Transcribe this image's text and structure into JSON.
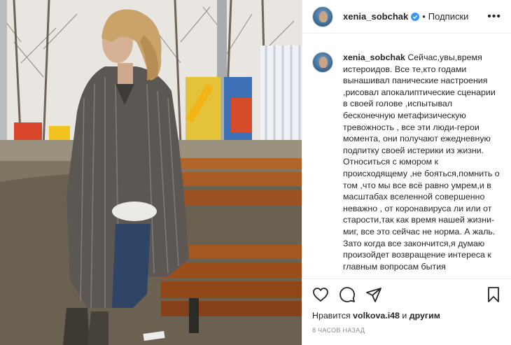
{
  "photo": {
    "alt_icon": "post-photo"
  },
  "header": {
    "username": "xenia_sobchak",
    "verified_icon": "verified-badge-icon",
    "separator": "•",
    "follow_label": "Подписки",
    "more_icon": "more-options-icon",
    "more_label": "•••"
  },
  "caption": {
    "username": "xenia_sobchak",
    "text": "Сейчас,увы,время истероидов. Все те,кто годами вынашивал панические настроения ,рисовал апокалиптические сценарии в своей голове ,испытывал бесконечную метафизическую тревожность , все эти люди-герои момента, они получают ежедневную подпитку своей истерики из жизни. Относиться с юмором к происходящему ,не бояться,помнить о том ,что мы все всё равно умрем,и в масштабах вселенной совершенно неважно , от коронавируса ли или от старости,так как время нашей жизни-миг, все это сейчас не норма. А жаль. Зато когда все закончится,я думаю произойдет возвращение интереса к главным вопросам бытия"
  },
  "actions": {
    "like_icon": "heart-icon",
    "comment_icon": "comment-icon",
    "share_icon": "share-icon",
    "save_icon": "bookmark-icon"
  },
  "likes": {
    "prefix": "Нравится ",
    "user": "volkova.i48",
    "suffix": " и ",
    "others": "другим"
  },
  "timestamp": "8 часов назад",
  "colors": {
    "text": "#262626",
    "muted": "#8e8e8e",
    "verified": "#3897f0",
    "border": "#efefef"
  }
}
